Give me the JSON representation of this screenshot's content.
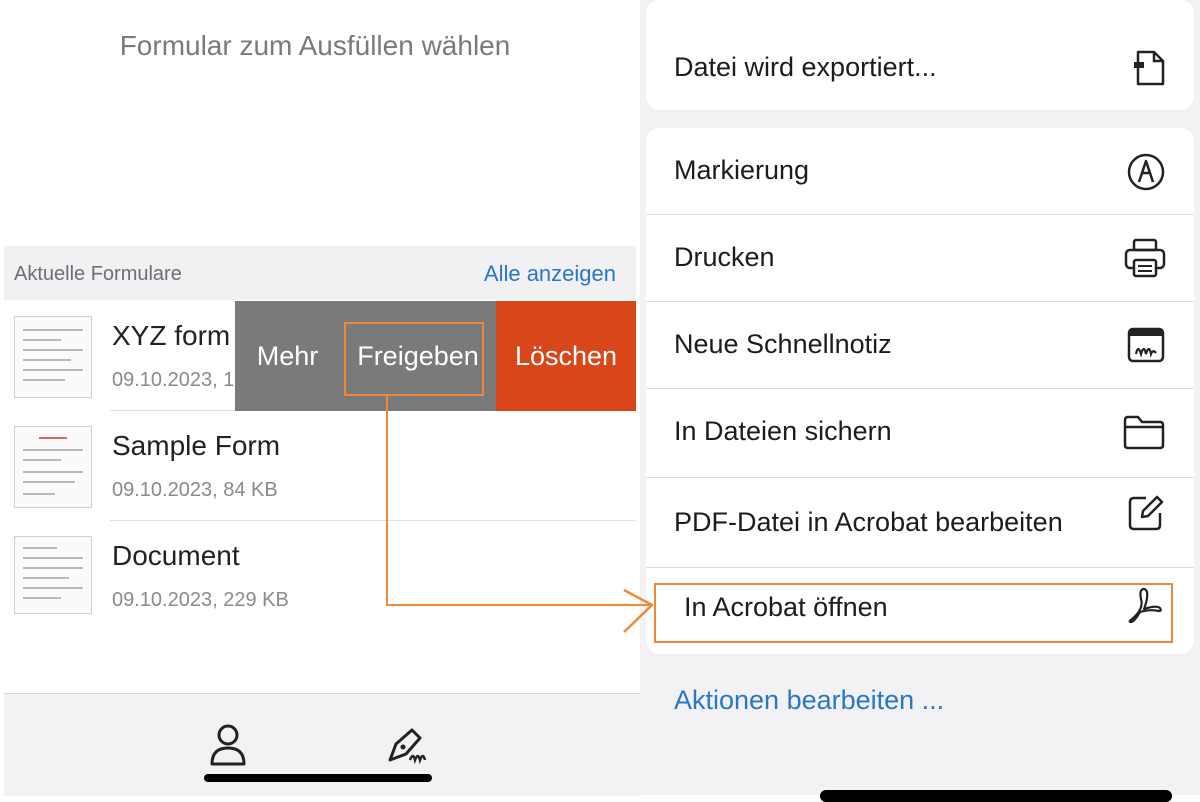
{
  "left": {
    "title": "Formular zum Ausfüllen wählen",
    "recent_label": "Aktuelle Formulare",
    "view_all": "Alle anzeigen",
    "documents": [
      {
        "name": "XYZ form",
        "meta": "09.10.2023, 1"
      },
      {
        "name": "Sample Form",
        "meta": "09.10.2023, 84 KB"
      },
      {
        "name": "Document",
        "meta": "09.10.2023, 229 KB"
      }
    ],
    "swipe_actions": {
      "more": "Mehr",
      "share": "Freigeben",
      "delete": "Löschen"
    },
    "tabs": [
      {
        "icon": "person-icon"
      },
      {
        "icon": "signature-pen-icon"
      }
    ]
  },
  "right": {
    "export_row": {
      "label": "Datei wird exportiert...",
      "icon": "document-export-icon"
    },
    "actions": [
      {
        "label": "Markierung",
        "icon": "markup-pen-icon"
      },
      {
        "label": "Drucken",
        "icon": "printer-icon"
      },
      {
        "label": "Neue Schnellnotiz",
        "icon": "quick-note-icon"
      },
      {
        "label": "In Dateien sichern",
        "icon": "folder-icon"
      },
      {
        "label": "PDF-Datei in Acrobat bearbeiten",
        "icon": "edit-square-icon"
      },
      {
        "label": "In Acrobat öffnen",
        "icon": "acrobat-icon"
      }
    ],
    "edit_actions": "Aktionen bearbeiten ..."
  },
  "colors": {
    "accent_blue": "#2a78c5",
    "delete_red": "#d8461a",
    "swipe_gray": "#7a7a7a",
    "annotation_orange": "#f0883a"
  }
}
